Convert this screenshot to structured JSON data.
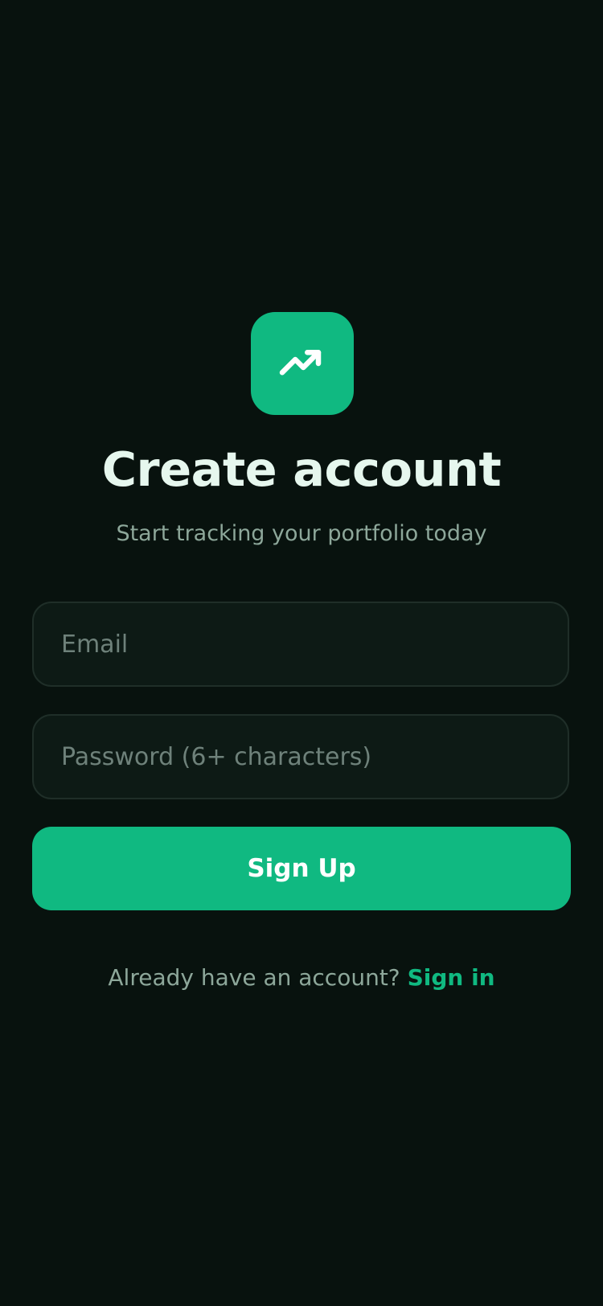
{
  "brand": {
    "icon": "trending-up-icon",
    "accent": "#10b981",
    "background": "#08120e"
  },
  "header": {
    "title": "Create account",
    "subtitle": "Start tracking your portfolio today"
  },
  "form": {
    "email_placeholder": "Email",
    "email_value": "",
    "password_placeholder": "Password (6+ characters)",
    "password_value": "",
    "submit_label": "Sign Up"
  },
  "footer": {
    "prompt": "Already have an account?",
    "link_label": "Sign in"
  }
}
